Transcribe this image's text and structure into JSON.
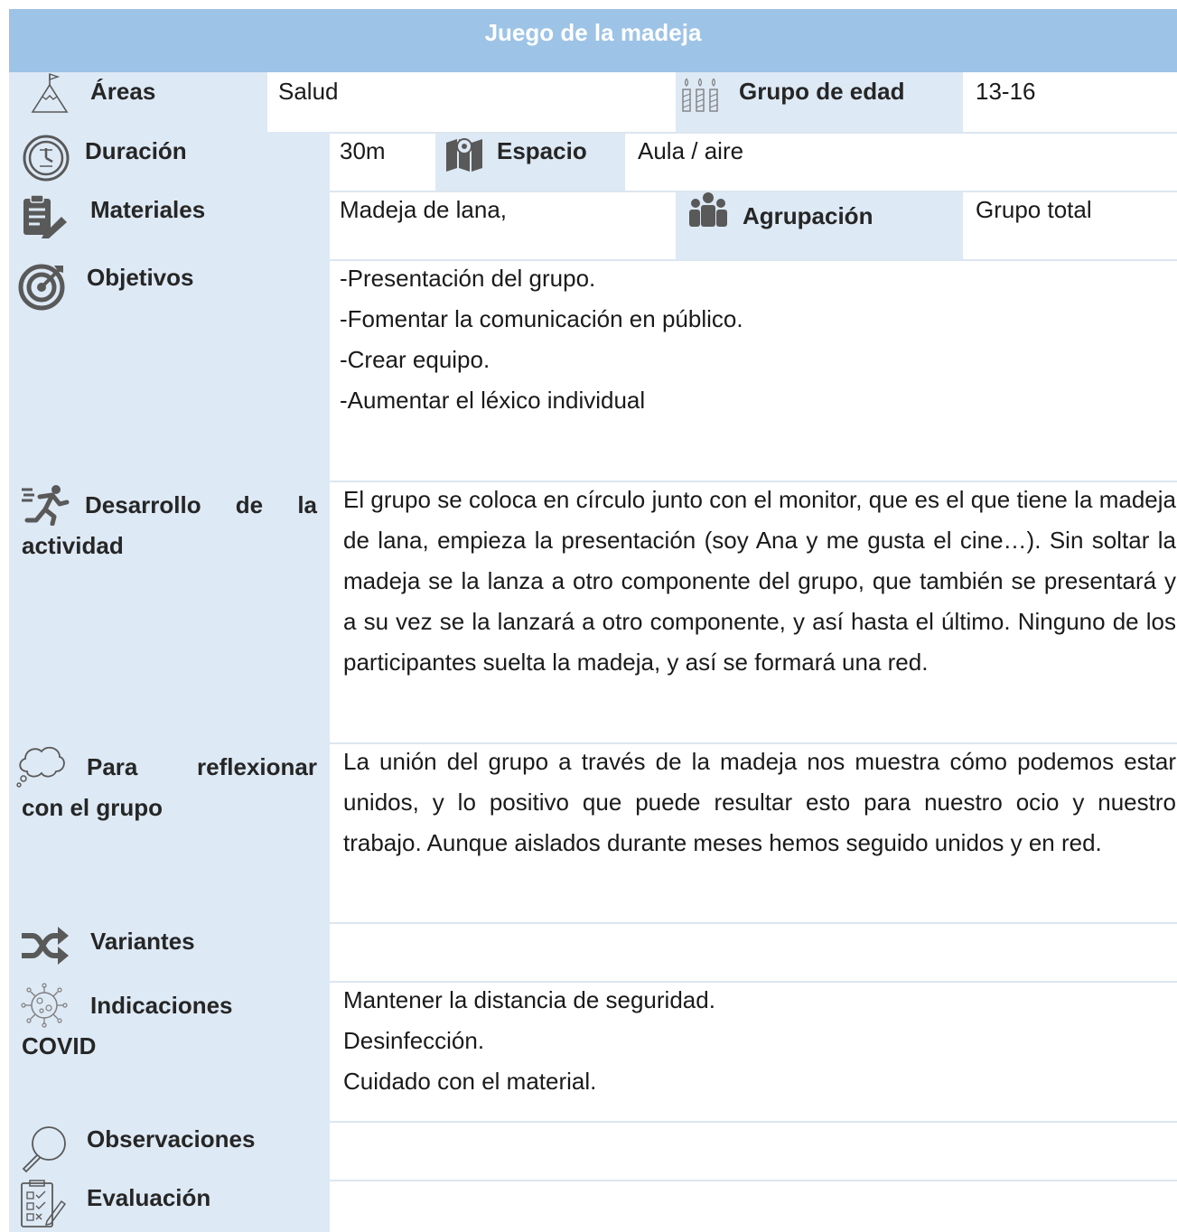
{
  "title": "Juego de la madeja",
  "areas": {
    "label": "Áreas",
    "value": "Salud"
  },
  "grupo_edad": {
    "label": "Grupo de edad",
    "value": "13-16"
  },
  "duracion": {
    "label": "Duración",
    "value": "30m"
  },
  "espacio": {
    "label": "Espacio",
    "value": "Aula / aire"
  },
  "materiales": {
    "label": "Materiales",
    "value": "Madeja de lana,"
  },
  "agrupacion": {
    "label": "Agrupación",
    "value": "Grupo total"
  },
  "objetivos": {
    "label": "Objetivos",
    "items": [
      "-Presentación del grupo.",
      "-Fomentar la comunicación en público.",
      "-Crear equipo.",
      "-Aumentar el léxico individual"
    ]
  },
  "desarrollo": {
    "label_line1": "Desarrollo de la",
    "label_line2": "actividad",
    "text": "El grupo se coloca en círculo junto con el monitor, que es el que tiene la madeja de lana, empieza la presentación (soy Ana y me gusta el cine…). Sin soltar la madeja se la lanza a otro componente del grupo, que también se presentará y a su vez se la lanzará a otro componente, y así hasta el último. Ninguno de los participantes suelta la madeja, y así se formará una red."
  },
  "reflexionar": {
    "label_line1": "Para reflexionar",
    "label_line2": "con el grupo",
    "text": "La unión del grupo a través de la madeja nos muestra cómo podemos estar unidos, y lo positivo que puede resultar esto para nuestro ocio y nuestro trabajo. Aunque aislados durante meses hemos seguido unidos y en red."
  },
  "variantes": {
    "label": "Variantes"
  },
  "covid": {
    "label_line1": "Indicaciones",
    "label_line2": "COVID",
    "items": [
      "Mantener la distancia de seguridad.",
      "Desinfección.",
      "Cuidado con el material."
    ]
  },
  "observaciones": {
    "label": "Observaciones"
  },
  "evaluacion": {
    "label": "Evaluación"
  },
  "colors": {
    "header_bg": "#9dc3e6",
    "label_bg": "#dde9f5",
    "icon": "#595959"
  }
}
